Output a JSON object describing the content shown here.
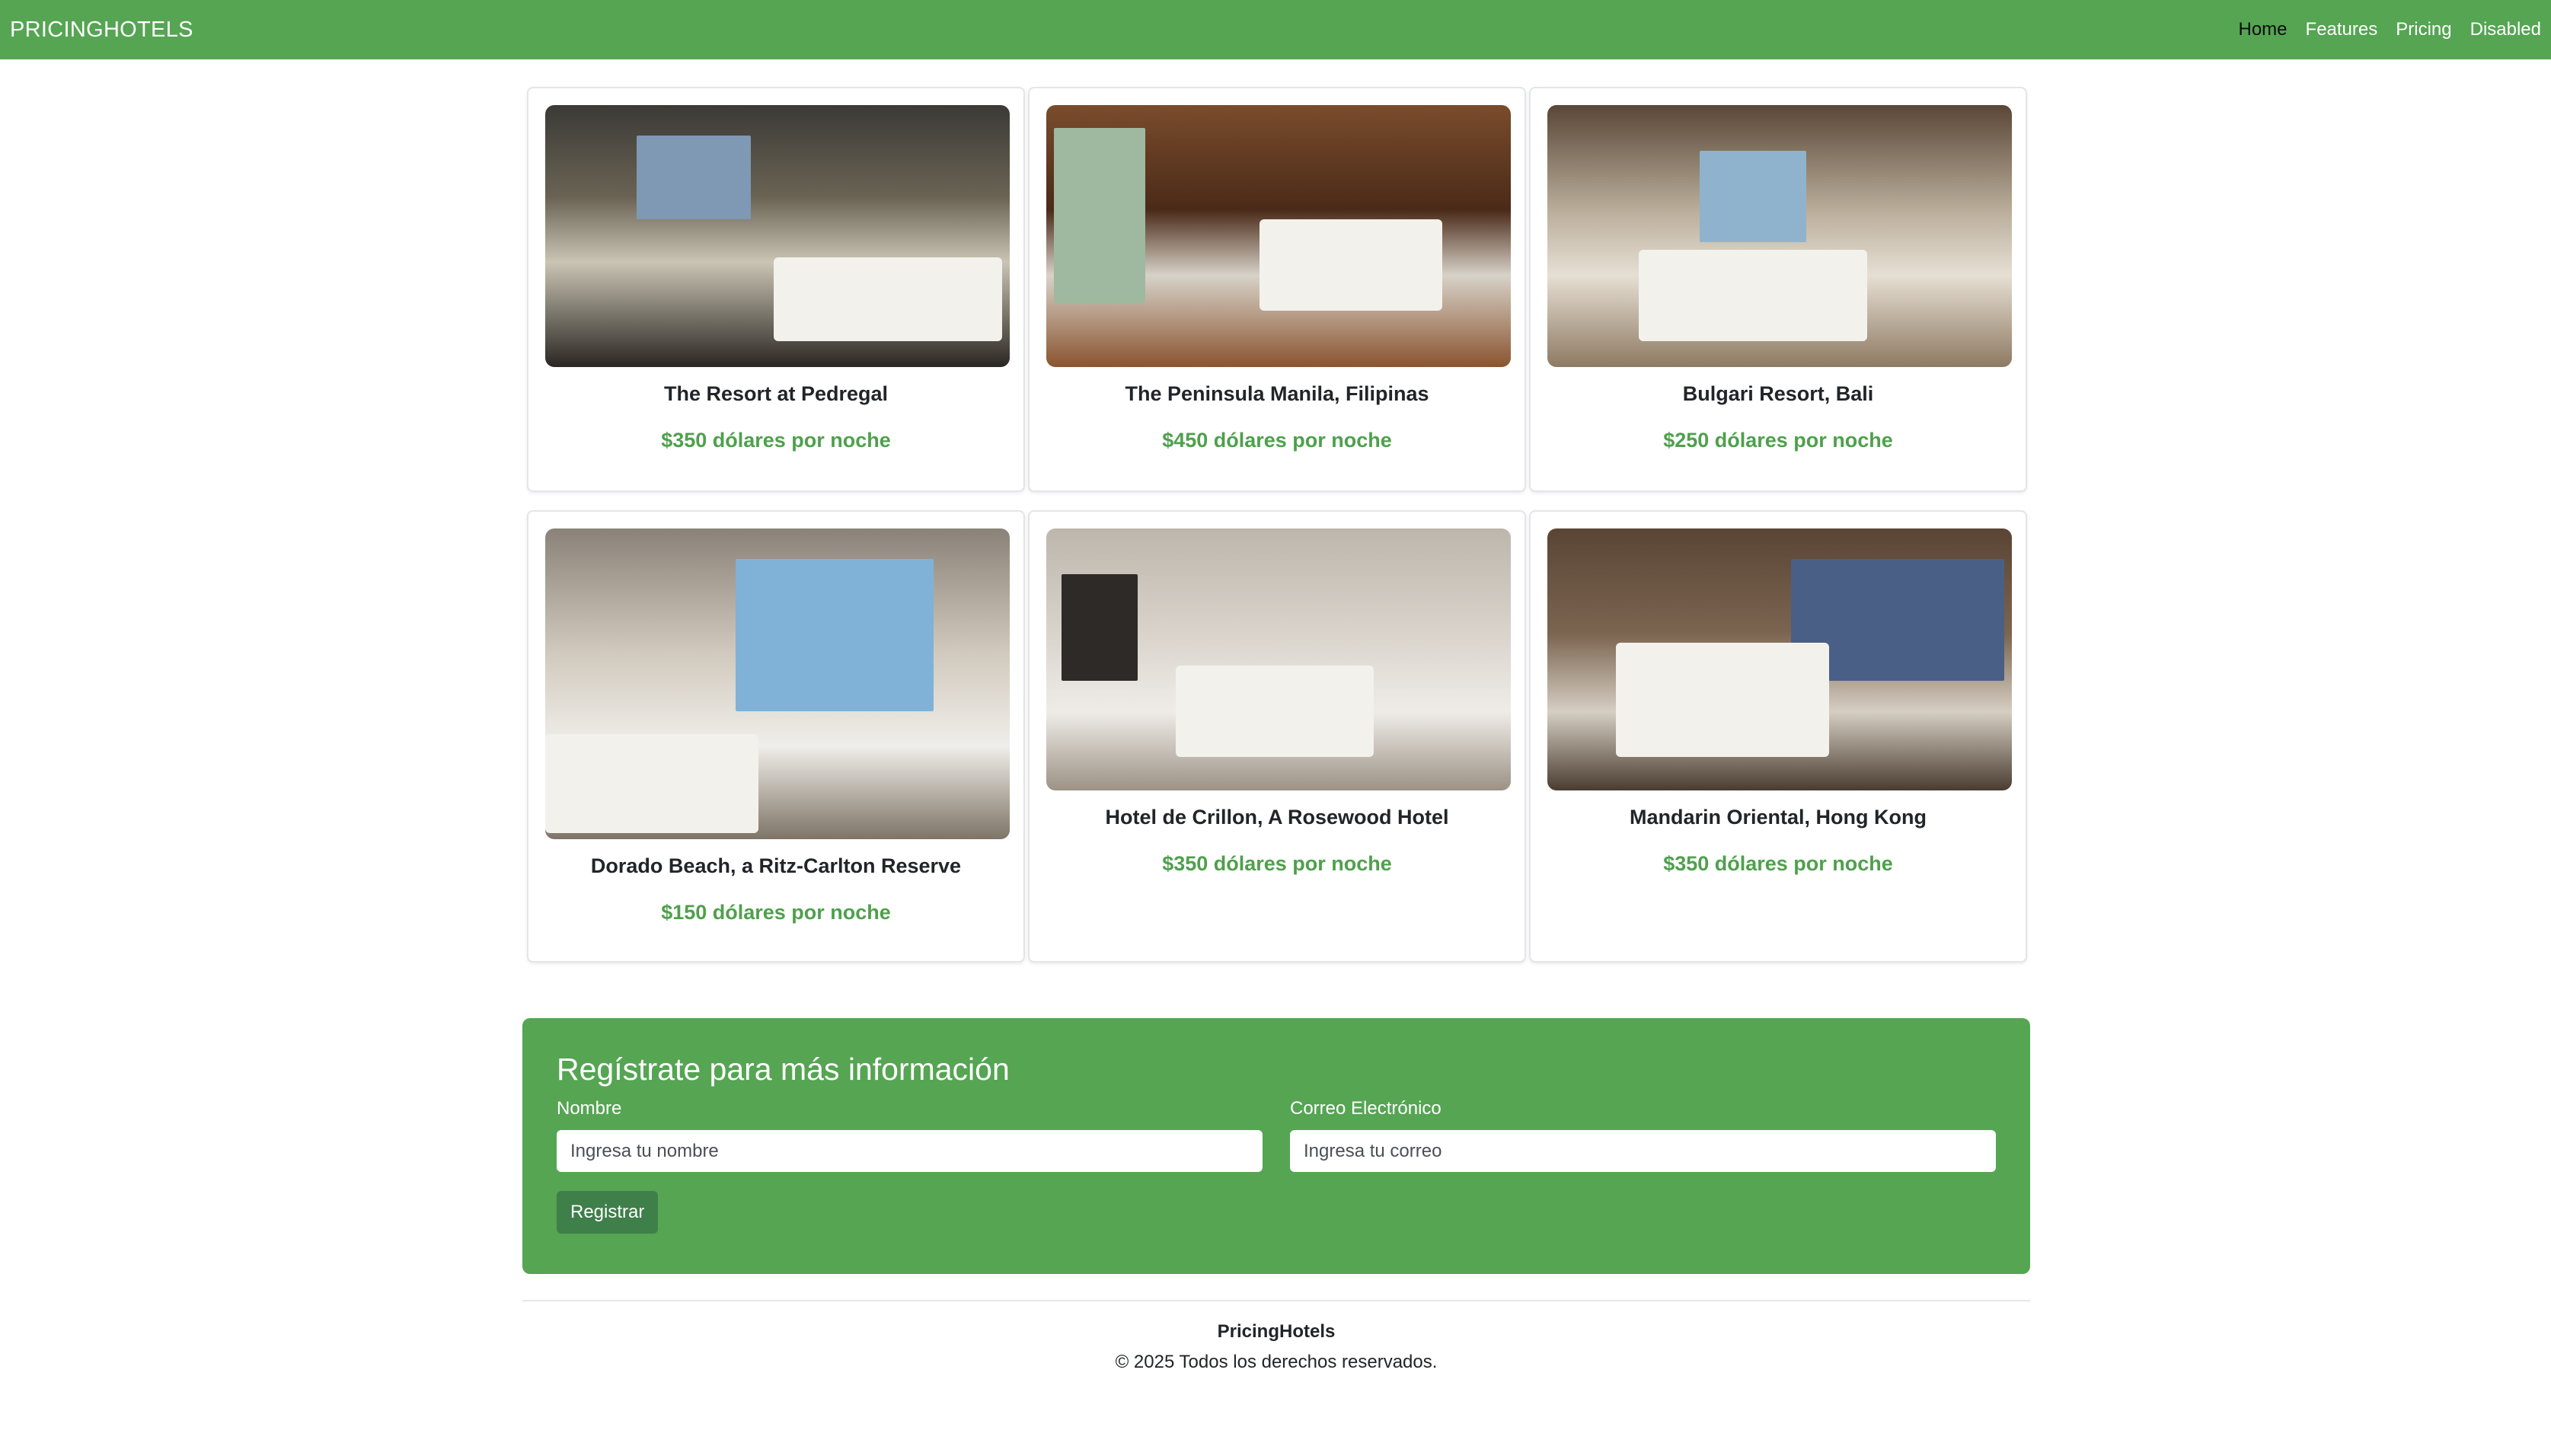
{
  "navbar": {
    "brand": "PRICINGHOTELS",
    "links": [
      {
        "label": "Home",
        "active": true
      },
      {
        "label": "Features",
        "active": false
      },
      {
        "label": "Pricing",
        "active": false
      },
      {
        "label": "Disabled",
        "active": false
      }
    ]
  },
  "hotels": [
    {
      "name": "The Resort at Pedregal",
      "price": "$350 dólares por noche"
    },
    {
      "name": "The Peninsula Manila, Filipinas",
      "price": "$450 dólares por noche"
    },
    {
      "name": "Bulgari Resort, Bali",
      "price": "$250 dólares por noche"
    },
    {
      "name": "Dorado Beach, a Ritz-Carlton Reserve",
      "price": "$150 dólares por noche"
    },
    {
      "name": "Hotel de Crillon, A Rosewood Hotel",
      "price": "$350 dólares por noche"
    },
    {
      "name": "Mandarin Oriental, Hong Kong",
      "price": "$350 dólares por noche"
    }
  ],
  "register": {
    "title": "Regístrate para más información",
    "name_label": "Nombre",
    "name_placeholder": "Ingresa tu nombre",
    "email_label": "Correo Electrónico",
    "email_placeholder": "Ingresa tu correo",
    "submit_label": "Registrar"
  },
  "footer": {
    "brand": "PricingHotels",
    "copyright": "© 2025 Todos los derechos reservados."
  },
  "colors": {
    "brand_green": "#55a553",
    "price_green": "#4fa04d",
    "button_green": "#3e7f4a"
  }
}
